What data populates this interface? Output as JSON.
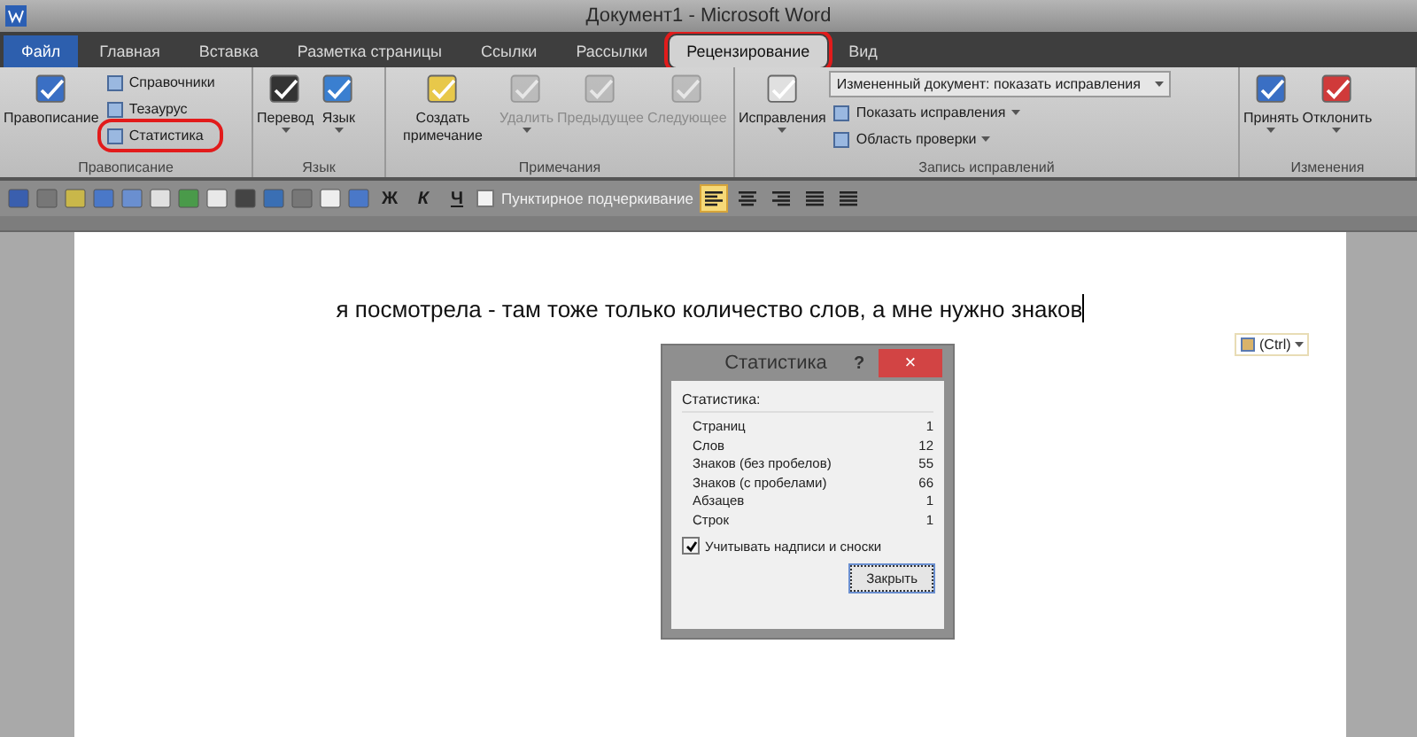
{
  "window": {
    "title": "Документ1 - Microsoft Word"
  },
  "tabs": [
    {
      "label": "Файл",
      "kind": "file",
      "selected": false,
      "highlighted": false
    },
    {
      "label": "Главная",
      "kind": "tab",
      "selected": false,
      "highlighted": false
    },
    {
      "label": "Вставка",
      "kind": "tab",
      "selected": false,
      "highlighted": false
    },
    {
      "label": "Разметка страницы",
      "kind": "tab",
      "selected": false,
      "highlighted": false
    },
    {
      "label": "Ссылки",
      "kind": "tab",
      "selected": false,
      "highlighted": false
    },
    {
      "label": "Рассылки",
      "kind": "tab",
      "selected": false,
      "highlighted": false
    },
    {
      "label": "Рецензирование",
      "kind": "tab",
      "selected": true,
      "highlighted": true
    },
    {
      "label": "Вид",
      "kind": "tab",
      "selected": false,
      "highlighted": false
    }
  ],
  "ribbon": {
    "groups": [
      {
        "label": "Правописание",
        "items": [
          {
            "kind": "large",
            "label": "Правописание",
            "disabled": false,
            "menu": false
          },
          {
            "kind": "small",
            "label": "Справочники",
            "menu": false,
            "highlighted": false
          },
          {
            "kind": "small",
            "label": "Тезаурус",
            "menu": false,
            "highlighted": false
          },
          {
            "kind": "small",
            "label": "Статистика",
            "menu": false,
            "highlighted": true
          }
        ]
      },
      {
        "label": "Язык",
        "items": [
          {
            "kind": "large",
            "label": "Перевод",
            "disabled": false,
            "menu": true
          },
          {
            "kind": "large",
            "label": "Язык",
            "disabled": false,
            "menu": true
          }
        ]
      },
      {
        "label": "Примечания",
        "items": [
          {
            "kind": "large",
            "label": "Создать примечание",
            "disabled": false,
            "menu": false
          },
          {
            "kind": "large",
            "label": "Удалить",
            "disabled": true,
            "menu": true
          },
          {
            "kind": "large",
            "label": "Предыдущее",
            "disabled": true,
            "menu": false
          },
          {
            "kind": "large",
            "label": "Следующее",
            "disabled": true,
            "menu": false
          }
        ]
      },
      {
        "label": "Запись исправлений",
        "items": [
          {
            "kind": "large",
            "label": "Исправления",
            "disabled": false,
            "menu": true
          },
          {
            "kind": "combo",
            "label": "Измененный документ: показать исправления",
            "menu": true
          },
          {
            "kind": "small",
            "label": "Показать исправления",
            "menu": true,
            "highlighted": false
          },
          {
            "kind": "small",
            "label": "Область проверки",
            "menu": true,
            "highlighted": false
          }
        ]
      },
      {
        "label": "Изменения",
        "items": [
          {
            "kind": "large",
            "label": "Принять",
            "disabled": false,
            "menu": true
          },
          {
            "kind": "large",
            "label": "Отклонить",
            "disabled": false,
            "menu": true
          }
        ]
      }
    ]
  },
  "toolbar": {
    "letter_buttons": [
      "Ж",
      "К",
      "Ч"
    ],
    "checkbox": {
      "label": "Пунктирное подчеркивание",
      "checked": false
    },
    "align_buttons": [
      {
        "selected": true
      },
      {
        "selected": false
      },
      {
        "selected": false
      },
      {
        "selected": false
      },
      {
        "selected": false
      }
    ]
  },
  "document": {
    "text": "я посмотрела - там тоже только количество слов, а мне нужно знаков",
    "paste_options": "(Ctrl)"
  },
  "dialog": {
    "title": "Статистика",
    "help": "?",
    "close": "×",
    "section": "Статистика:",
    "rows": [
      {
        "label": "Страниц",
        "value": "1"
      },
      {
        "label": "Слов",
        "value": "12"
      },
      {
        "label": "Знаков (без пробелов)",
        "value": "55"
      },
      {
        "label": "Знаков (с пробелами)",
        "value": "66"
      },
      {
        "label": "Абзацев",
        "value": "1"
      },
      {
        "label": "Строк",
        "value": "1"
      }
    ],
    "checkbox": {
      "label": "Учитывать надписи и сноски",
      "checked": true
    },
    "button": "Закрыть"
  }
}
